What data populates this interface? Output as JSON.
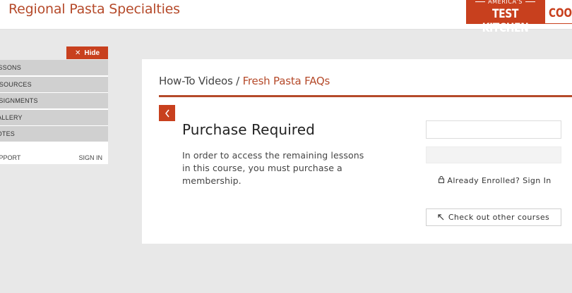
{
  "header": {
    "site_title": "Regional Pasta Specialties",
    "brand": {
      "atk_small": "AMERICA'S",
      "atk_big": "TEST KITCHEN",
      "cook": "COOK"
    }
  },
  "sidebar": {
    "hide_label": "Hide",
    "hide_icon": "close-icon",
    "items": [
      {
        "label": "LESSONS"
      },
      {
        "label": "RESOURCES"
      },
      {
        "label": "ASSIGNMENTS"
      },
      {
        "label": "GALLERY"
      },
      {
        "label": "NOTES"
      }
    ],
    "support_label": "SUPPORT",
    "signin_label": "SIGN IN"
  },
  "main": {
    "breadcrumb_parent": "How-To Videos",
    "breadcrumb_sep": " / ",
    "breadcrumb_current": "Fresh Pasta FAQs",
    "back_icon": "chevron-left-icon",
    "purchase_title": "Purchase Required",
    "purchase_text": "In order to access the remaining lessons in this course, you must purchase a membership.",
    "enrolled_label": "Already Enrolled? Sign In",
    "enrolled_icon": "lock-icon",
    "other_courses_label": "Check out other courses",
    "other_courses_icon": "arrow-up-left-icon"
  },
  "colors": {
    "accent": "#c8401e",
    "title": "#b54a2a",
    "sidebar_item_bg": "#d0d0d0",
    "page_bg": "#e8e8e8"
  }
}
